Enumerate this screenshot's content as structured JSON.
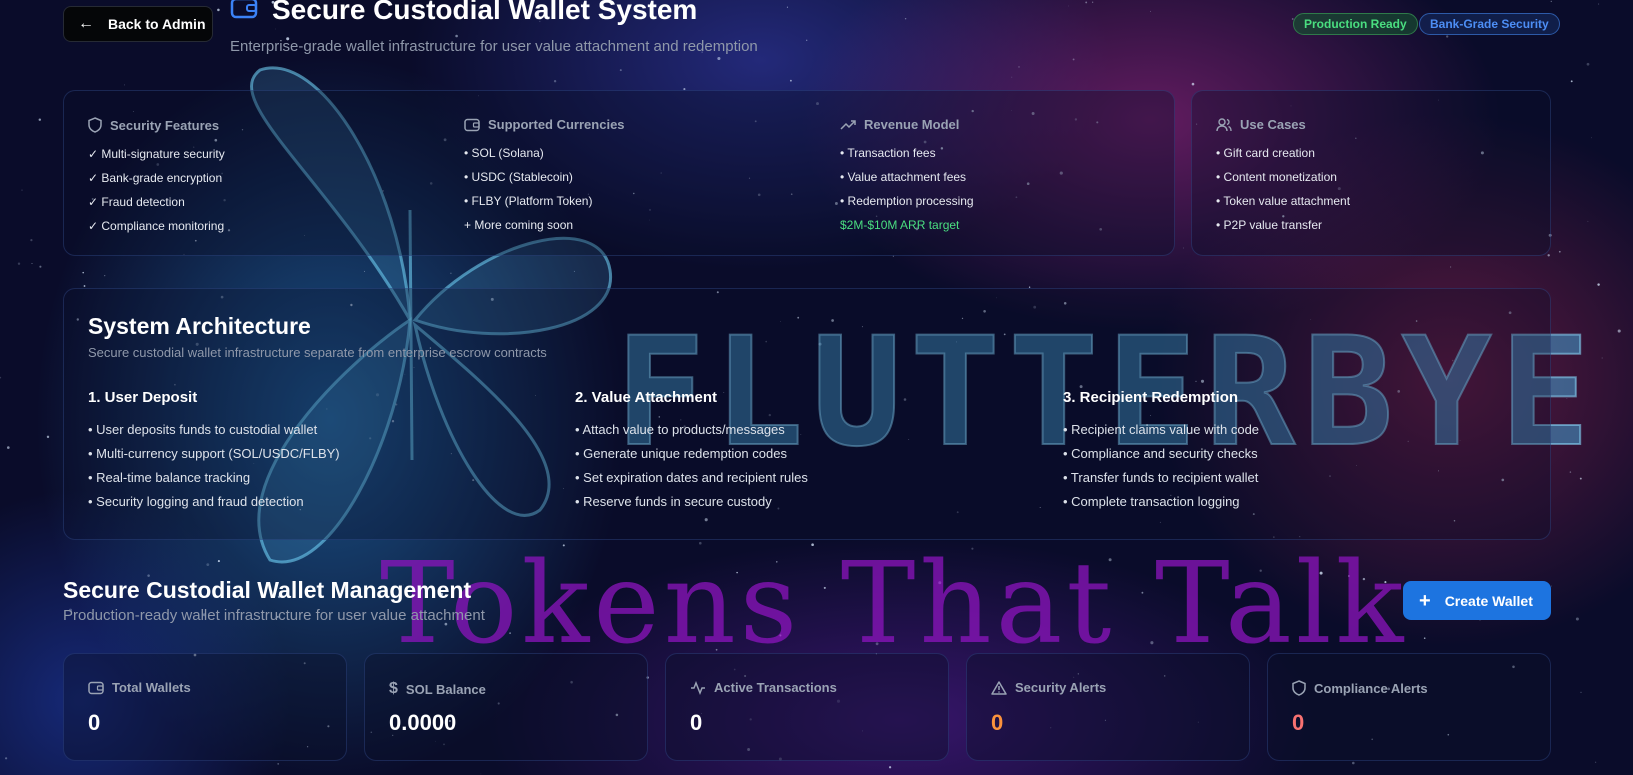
{
  "header": {
    "back_label": "Back to Admin",
    "title": "Secure Custodial Wallet System",
    "subtitle": "Enterprise-grade wallet infrastructure for user value attachment and redemption",
    "badges": [
      {
        "label": "Production Ready",
        "color": "#4ade80"
      },
      {
        "label": "Bank-Grade Security",
        "color": "#4d8ef5"
      }
    ]
  },
  "features": [
    {
      "title": "Security Features",
      "icon": "shield-icon",
      "items": [
        "✓ Multi-signature security",
        "✓ Bank-grade encryption",
        "✓ Fraud detection",
        "✓ Compliance monitoring"
      ]
    },
    {
      "title": "Supported Currencies",
      "icon": "wallet-icon",
      "items": [
        "• SOL (Solana)",
        "• USDC (Stablecoin)",
        "• FLBY (Platform Token)",
        "+ More coming soon"
      ]
    },
    {
      "title": "Revenue Model",
      "icon": "trending-up-icon",
      "items": [
        "• Transaction fees",
        "• Value attachment fees",
        "• Redemption processing"
      ],
      "highlight": "$2M-$10M ARR target"
    },
    {
      "title": "Use Cases",
      "icon": "users-icon",
      "items": [
        "• Gift card creation",
        "• Content monetization",
        "• Token value attachment",
        "• P2P value transfer"
      ]
    }
  ],
  "architecture": {
    "title": "System Architecture",
    "subtitle": "Secure custodial wallet infrastructure separate from enterprise escrow contracts",
    "steps": [
      {
        "title": "1. User Deposit",
        "items": [
          "• User deposits funds to custodial wallet",
          "• Multi-currency support (SOL/USDC/FLBY)",
          "• Real-time balance tracking",
          "• Security logging and fraud detection"
        ]
      },
      {
        "title": "2. Value Attachment",
        "items": [
          "• Attach value to products/messages",
          "• Generate unique redemption codes",
          "• Set expiration dates and recipient rules",
          "• Reserve funds in secure custody"
        ]
      },
      {
        "title": "3. Recipient Redemption",
        "items": [
          "• Recipient claims value with code",
          "• Compliance and security checks",
          "• Transfer funds to recipient wallet",
          "• Complete transaction logging"
        ]
      }
    ]
  },
  "management": {
    "title": "Secure Custodial Wallet Management",
    "subtitle": "Production-ready wallet infrastructure for user value attachment",
    "create_label": "Create Wallet"
  },
  "stats": [
    {
      "label": "Total Wallets",
      "icon": "wallet-icon",
      "value": "0",
      "color": "#ffffff"
    },
    {
      "label": "SOL Balance",
      "icon": "dollar-icon",
      "value": "0.0000",
      "color": "#ffffff"
    },
    {
      "label": "Active Transactions",
      "icon": "activity-icon",
      "value": "0",
      "color": "#ffffff"
    },
    {
      "label": "Security Alerts",
      "icon": "alert-triangle-icon",
      "value": "0",
      "color": "#fb923c"
    },
    {
      "label": "Compliance Alerts",
      "icon": "shield-icon",
      "value": "0",
      "color": "#f87171"
    }
  ],
  "background": {
    "logo_text": "FLUTTERBYE",
    "tagline": "Tokens That Talk"
  }
}
